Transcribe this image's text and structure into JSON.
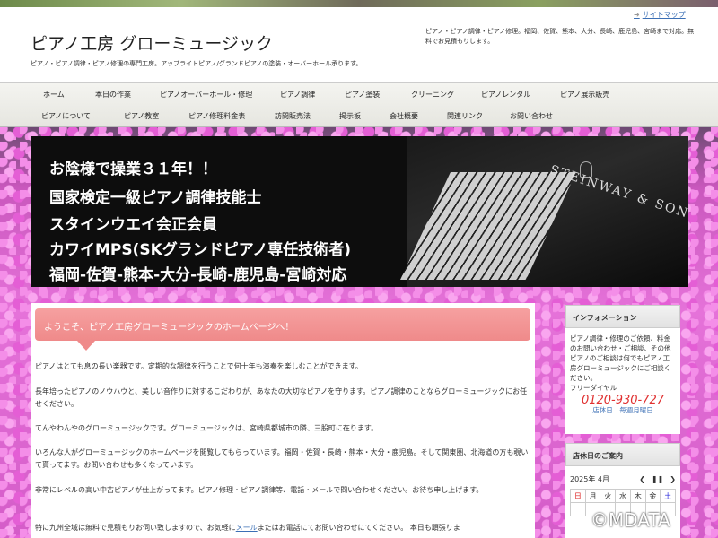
{
  "header": {
    "site_title": "ピアノ工房 グローミュージック",
    "site_description": "ピアノ・ピアノ調律・ピアノ修理の専門工房。アップライトピアノ/グランドピアノの塗装・オーバーホール承ります。",
    "sitemap_label": "サイトマップ",
    "right_text": "ピアノ・ピアノ調律・ピアノ修理。福岡、佐賀、熊本、大分、長崎、鹿児島、宮崎まで対応。無料でお見積もりします。"
  },
  "nav": {
    "row1": [
      "ホーム",
      "本日の作業",
      "ピアノオーバーホール・修理",
      "ピアノ調律",
      "ピアノ塗装",
      "クリーニング",
      "ピアノレンタル",
      "ピアノ展示販売"
    ],
    "row2": [
      "ピアノについて",
      "ピアノ教室",
      "ピアノ修理料金表",
      "訪問販売法",
      "掲示板",
      "会社概要",
      "関連リンク",
      "お問い合わせ"
    ]
  },
  "hero": {
    "lines": [
      "お陰様で操業３１年！！",
      "国家検定一級ピアノ調律技能士",
      "スタインウエイ会正会員",
      "カワイMPS(SKグランドピアノ専任技術者)",
      "福岡-佐賀-熊本-大分-長崎-鹿児島-宮崎対応"
    ],
    "brand": "STEINWAY & SONS"
  },
  "main": {
    "welcome": "ようこそ、ピアノ工房グローミュージックのホームページへ！",
    "paragraphs": [
      "ピアノはとても息の長い楽器です。定期的な調律を行うことで何十年も演奏を楽しむことができます。",
      "長年培ったピアノのノウハウと、美しい音作りに対するこだわりが、あなたの大切なピアノを守ります。ピアノ調律のことならグローミュージックにお任せください。",
      "てんやわんやのグローミュージックです。グローミュージックは、宮崎県都城市の隣、三股町に在ります。",
      "いろんな人がグローミュージックのホームページを閲覧してもらっています。福岡・佐賀・長崎・熊本・大分・鹿児島。そして関東圏、北海道の方も覗いて貰ってます。お問い合わせも多くなっています。",
      "非常にレベルの高い中古ピアノが仕上がってます。ピアノ修理・ピアノ調律等、電話・メールで問い合わせください。お待ち申し上げます。"
    ],
    "last_para_pre": "特に九州全域は無料で見積もりお伺い致しますので、お気軽に",
    "last_para_link": "メール",
    "last_para_post": "またはお電話にてお問い合わせにてください。 本日も頑張りま"
  },
  "sidebar": {
    "info_title": "インフォメーション",
    "info_text": "ピアノ調律・修理のご依頼、料金のお問い合わせ・ご相談、その他ピアノのご相談は何でもピアノ工房グローミュージックにご相談ください。",
    "free_dial_label": "フリーダイヤル",
    "phone": "0120-930-727",
    "hours": "店休日　毎週月曜日",
    "calendar_title": "店休日のご案内",
    "calendar_month": "2025年 4月",
    "weekdays": [
      "日",
      "月",
      "火",
      "水",
      "木",
      "金",
      "土"
    ]
  },
  "watermark": "©MDATA"
}
